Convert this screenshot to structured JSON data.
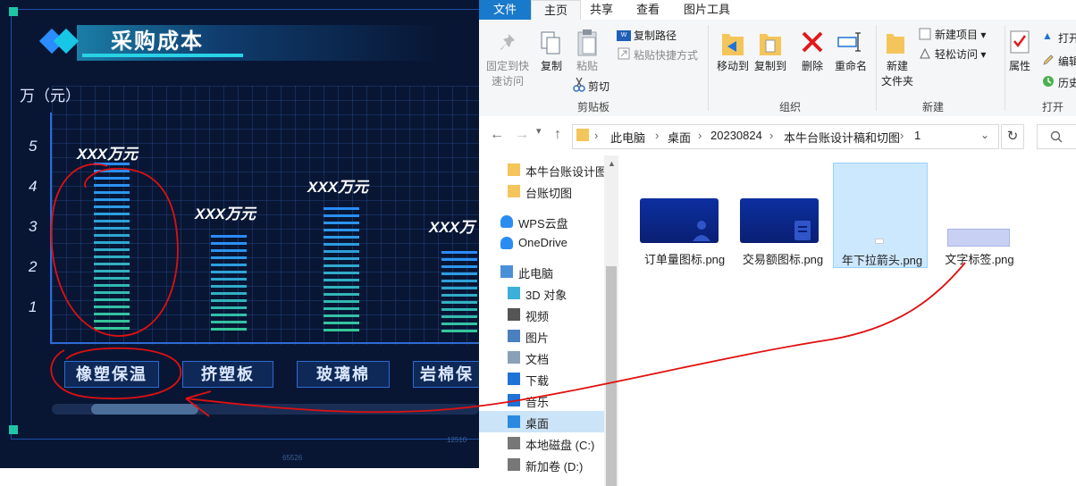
{
  "dashboard": {
    "title": "采购成本",
    "unit": "万（元）",
    "y_ticks": [
      "5",
      "4",
      "3",
      "2",
      "1"
    ],
    "bars": [
      {
        "label": "XXX万元",
        "category": "橡塑保温",
        "value": 4.4
      },
      {
        "label": "XXX万元",
        "category": "挤塑板",
        "value": 2.6
      },
      {
        "label": "XXX万元",
        "category": "玻璃棉",
        "value": 3.3
      },
      {
        "label": "XXX万",
        "category": "岩棉保",
        "value": 2.2
      }
    ],
    "tiny_texts": [
      "12510",
      "65526"
    ],
    "colors": {
      "background": "#081634",
      "accent": "#28d3e6",
      "bar_top": "#2a8cff",
      "bar_bottom": "#35c79a",
      "annotation": "#e01010"
    }
  },
  "explorer": {
    "tabs": [
      "文件",
      "主页",
      "共享",
      "查看",
      "图片工具"
    ],
    "active_tab": "主页",
    "ribbon": {
      "clipboard": {
        "pin": "固定到快\n速访问",
        "copy": "复制",
        "paste": "粘贴",
        "copy_path": "复制路径",
        "paste_shortcut": "粘贴快捷方式",
        "cut": "剪切",
        "group": "剪贴板"
      },
      "organize": {
        "move_to": "移动到",
        "copy_to": "复制到",
        "delete": "删除",
        "rename": "重命名",
        "group": "组织"
      },
      "new": {
        "new_folder": "新建\n文件夹",
        "new_item": "新建项目",
        "easy_access": "轻松访问",
        "group": "新建"
      },
      "open": {
        "properties": "属性",
        "open": "打开",
        "edit": "编辑",
        "history": "历史",
        "group": "打开"
      }
    },
    "address": {
      "segments": [
        "此电脑",
        "桌面",
        "20230824",
        "本牛台账设计稿和切图",
        "1"
      ],
      "search_icon": "magnifier-icon"
    },
    "tree": [
      {
        "label": "本牛台账设计图",
        "icon": "folder-icon"
      },
      {
        "label": "台账切图",
        "icon": "folder-icon"
      },
      {
        "label": "WPS云盘",
        "icon": "cloud-icon"
      },
      {
        "label": "OneDrive",
        "icon": "cloud-icon"
      },
      {
        "label": "此电脑",
        "icon": "computer-icon"
      },
      {
        "label": "3D 对象",
        "icon": "cube-icon"
      },
      {
        "label": "视频",
        "icon": "video-icon"
      },
      {
        "label": "图片",
        "icon": "picture-icon"
      },
      {
        "label": "文档",
        "icon": "document-icon"
      },
      {
        "label": "下载",
        "icon": "download-icon"
      },
      {
        "label": "音乐",
        "icon": "music-icon"
      },
      {
        "label": "桌面",
        "icon": "desktop-icon"
      },
      {
        "label": "本地磁盘 (C:)",
        "icon": "drive-icon"
      },
      {
        "label": "新加卷 (D:)",
        "icon": "drive-icon"
      }
    ],
    "files": [
      {
        "name": "订单量图标.png",
        "selected": false
      },
      {
        "name": "交易额图标.png",
        "selected": false
      },
      {
        "name": "年下拉箭头.png",
        "selected": true
      },
      {
        "name": "文字标签.png",
        "selected": false
      }
    ]
  }
}
